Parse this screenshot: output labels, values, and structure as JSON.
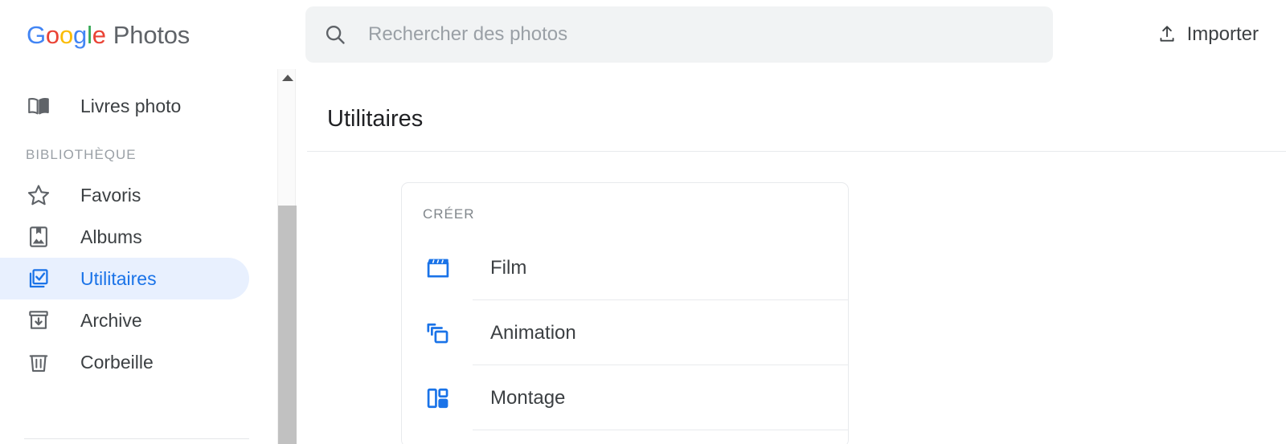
{
  "header": {
    "brand": {
      "google": "Google",
      "product": "Photos"
    },
    "search": {
      "placeholder": "Rechercher des photos",
      "value": "",
      "icon": "search-icon"
    },
    "import_button": {
      "label": "Importer",
      "icon": "upload-icon"
    }
  },
  "sidebar": {
    "top_items": [
      {
        "label": "Livres photo",
        "icon": "photo-book-icon",
        "active": false
      }
    ],
    "section_label": "BIBLIOTHÈQUE",
    "library_items": [
      {
        "label": "Favoris",
        "icon": "star-icon",
        "active": false
      },
      {
        "label": "Albums",
        "icon": "album-icon",
        "active": false
      },
      {
        "label": "Utilitaires",
        "icon": "utilities-icon",
        "active": true
      },
      {
        "label": "Archive",
        "icon": "archive-icon",
        "active": false
      },
      {
        "label": "Corbeille",
        "icon": "trash-icon",
        "active": false
      }
    ],
    "scrollbar": {
      "up_arrow_icon": "scroll-up-arrow-icon"
    }
  },
  "main": {
    "page_title": "Utilitaires",
    "create_card": {
      "heading": "CRÉER",
      "items": [
        {
          "label": "Film",
          "icon": "movie-clapper-icon"
        },
        {
          "label": "Animation",
          "icon": "stacked-frames-icon"
        },
        {
          "label": "Montage",
          "icon": "collage-icon"
        }
      ]
    }
  },
  "colors": {
    "accent_blue": "#1a73e8",
    "active_pill_bg": "#e8f0fe",
    "text_primary": "#3c4043",
    "text_muted": "#9aa0a6",
    "divider": "#e8eaed",
    "search_bg": "#f1f3f4"
  }
}
